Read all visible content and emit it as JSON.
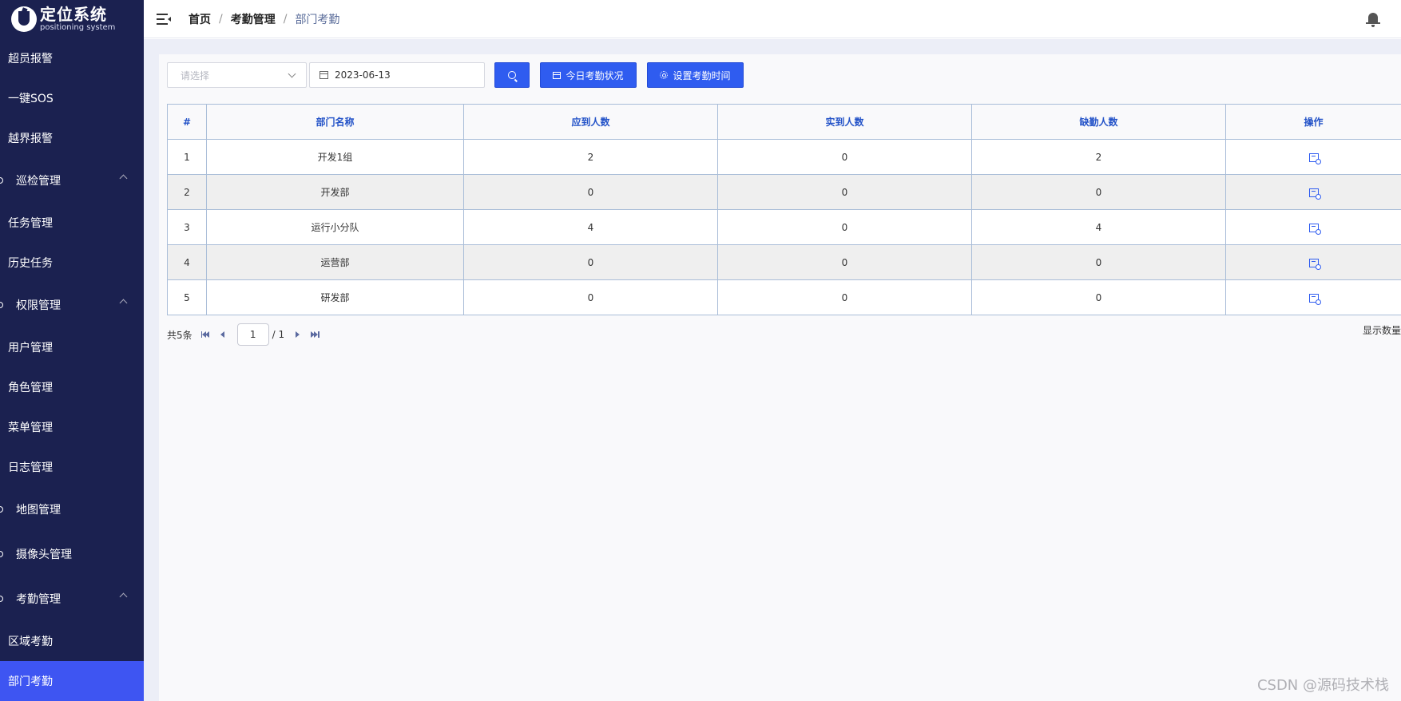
{
  "app": {
    "title": "定位系统",
    "subtitle": "positioning system"
  },
  "sidebar": {
    "items": [
      {
        "label": "超员报警",
        "kind": "sub"
      },
      {
        "label": "一键SOS",
        "kind": "sub"
      },
      {
        "label": "越界报警",
        "kind": "sub"
      },
      {
        "label": "巡检管理",
        "kind": "group"
      },
      {
        "label": "任务管理",
        "kind": "sub"
      },
      {
        "label": "历史任务",
        "kind": "sub"
      },
      {
        "label": "权限管理",
        "kind": "group"
      },
      {
        "label": "用户管理",
        "kind": "sub"
      },
      {
        "label": "角色管理",
        "kind": "sub"
      },
      {
        "label": "菜单管理",
        "kind": "sub"
      },
      {
        "label": "日志管理",
        "kind": "sub"
      },
      {
        "label": "地图管理",
        "kind": "group"
      },
      {
        "label": "摄像头管理",
        "kind": "group"
      },
      {
        "label": "考勤管理",
        "kind": "group"
      },
      {
        "label": "区域考勤",
        "kind": "sub"
      },
      {
        "label": "部门考勤",
        "kind": "sub",
        "active": true
      }
    ]
  },
  "header": {
    "breadcrumb": [
      "首页",
      "考勤管理",
      "部门考勤"
    ],
    "separator": "/"
  },
  "filters": {
    "select_placeholder": "请选择",
    "date_value": "2023-06-13",
    "today_button": "今日考勤状况",
    "set_button": "设置考勤时间"
  },
  "table": {
    "columns": [
      "#",
      "部门名称",
      "应到人数",
      "实到人数",
      "缺勤人数",
      "操作"
    ],
    "rows": [
      [
        "1",
        "开发1组",
        "2",
        "0",
        "2"
      ],
      [
        "2",
        "开发部",
        "0",
        "0",
        "0"
      ],
      [
        "3",
        "运行小分队",
        "4",
        "0",
        "4"
      ],
      [
        "4",
        "运营部",
        "0",
        "0",
        "0"
      ],
      [
        "5",
        "研发部",
        "0",
        "0",
        "0"
      ]
    ]
  },
  "pagination": {
    "total": "共5条",
    "page": "1",
    "pages": "/ 1",
    "show_count_label": "显示数量"
  },
  "watermark": "CSDN @源码技术栈",
  "colors": {
    "sidebar_bg": "#1b2150",
    "accent": "#2f5cf0",
    "active_item": "#3e55f2"
  }
}
